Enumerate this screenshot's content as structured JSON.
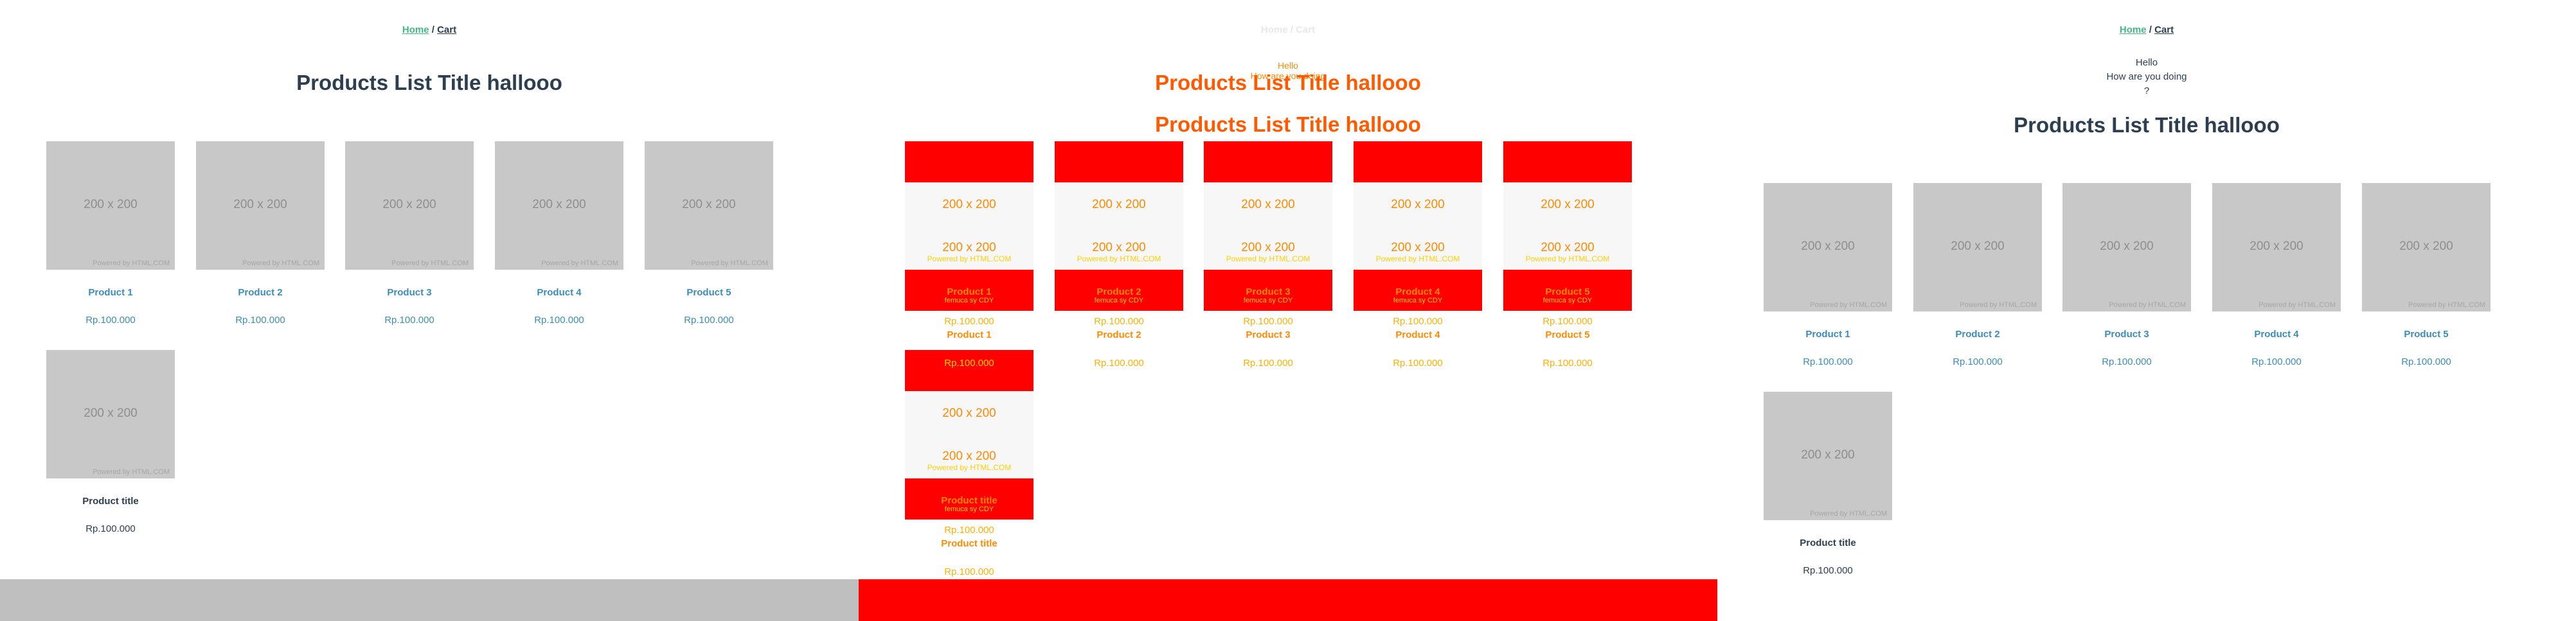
{
  "nav": {
    "home": "Home",
    "sep": "/",
    "cart": "Cart"
  },
  "title": "Products List Title hallooo",
  "greeting": {
    "line1": "Hello",
    "line2": "How are you doing",
    "line3": "?"
  },
  "placeholder": {
    "size": "200 x 200",
    "powered": "Powered by HTML.COM"
  },
  "products": [
    {
      "name": "Product 1",
      "price": "Rp.100.000"
    },
    {
      "name": "Product 2",
      "price": "Rp.100.000"
    },
    {
      "name": "Product 3",
      "price": "Rp.100.000"
    },
    {
      "name": "Product 4",
      "price": "Rp.100.000"
    },
    {
      "name": "Product 5",
      "price": "Rp.100.000"
    }
  ],
  "extra_product": {
    "name": "Product title",
    "price": "Rp.100.000"
  },
  "debug": {
    "overlay_top": "Home / Cart",
    "overlay_hello": "Hello",
    "overlay_sub": "How are you doing",
    "caption": "femuca sy  CDY",
    "product_ghost": "Product title"
  },
  "colors": {
    "link_green": "#42b983",
    "text_dark": "#2c3e50",
    "link_blue": "#3b8db8",
    "debug_red": "#ff0000",
    "debug_orange": "#ff5a00"
  }
}
